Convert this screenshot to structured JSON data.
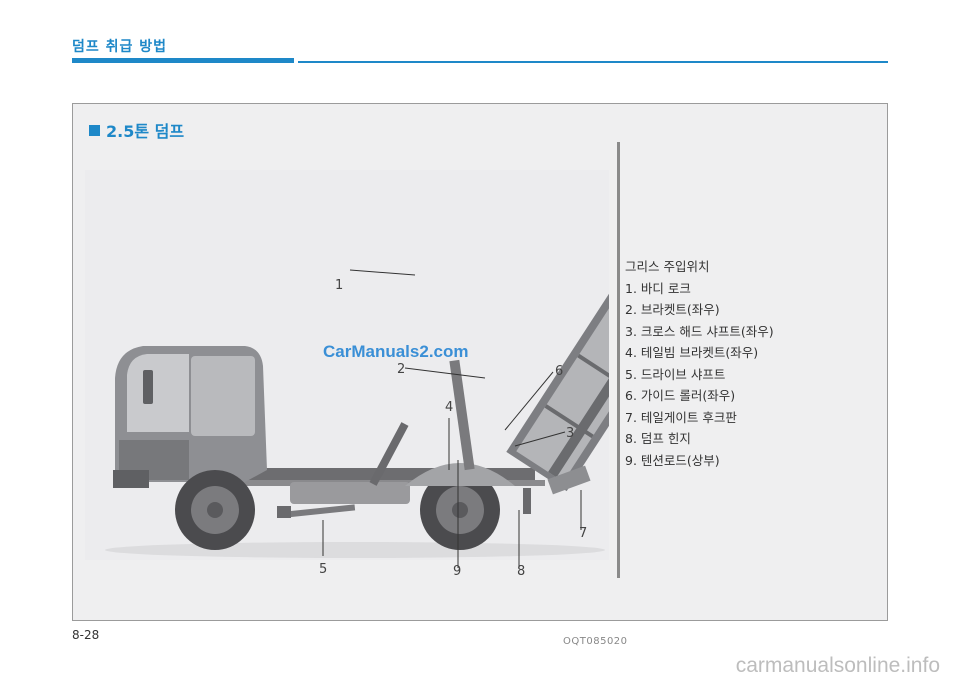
{
  "header": {
    "title": "덤프 취급 방법"
  },
  "section": {
    "title": "2.5톤 덤프"
  },
  "figure": {
    "code": "OQT085020",
    "watermark": "CarManuals2.com",
    "callouts": [
      "1",
      "2",
      "3",
      "4",
      "5",
      "6",
      "7",
      "8",
      "9"
    ]
  },
  "legend": {
    "heading": "그리스 주입위치",
    "items": [
      "1. 바디 로크",
      "2. 브라켓트(좌우)",
      "3. 크로스 해드 샤프트(좌우)",
      "4. 테일빔 브라켓트(좌우)",
      "5. 드라이브 샤프트",
      "6. 가이드 롤러(좌우)",
      "7. 테일게이트 후크판",
      "8. 덤프 힌지",
      "9. 텐션로드(상부)"
    ]
  },
  "page": {
    "number": "8-28"
  },
  "footer": {
    "site": "carmanualsonline.info"
  }
}
